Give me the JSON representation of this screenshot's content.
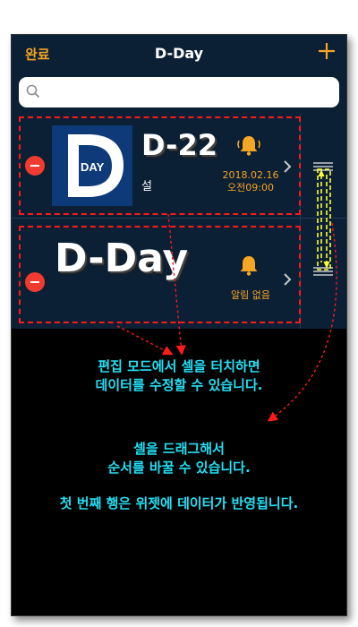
{
  "nav": {
    "done_label": "완료",
    "title": "D-Day",
    "add_icon": "plus-icon"
  },
  "search": {
    "placeholder": "",
    "icon": "search-icon"
  },
  "cells": [
    {
      "logo_text": "DAY",
      "dday": "D-22",
      "label": "설",
      "alarm_icon": "bell-ringing-icon",
      "date": "2018.02.16",
      "time": "오전09:00"
    },
    {
      "dday": "D-Day",
      "alarm_icon": "bell-icon",
      "alarm_text": "알림 없음"
    }
  ],
  "annotations": {
    "edit_line1": "편집 모드에서 셀을 터치하면",
    "edit_line2": "데이터를 수정할 수 있습니다.",
    "drag_line1": "셀을 드래그해서",
    "drag_line2": "순서를 바꿀 수 있습니다.",
    "widget_line": "첫 번째 행은 위젯에 데이터가 반영됩니다."
  },
  "colors": {
    "nav_bg": "#0b1f35",
    "accent": "#f5a623",
    "delete_red": "#f23b30",
    "annotation_cyan": "#22e0f5",
    "dash_red": "#ff1a1a",
    "arrow_yellow": "#ffff33"
  }
}
